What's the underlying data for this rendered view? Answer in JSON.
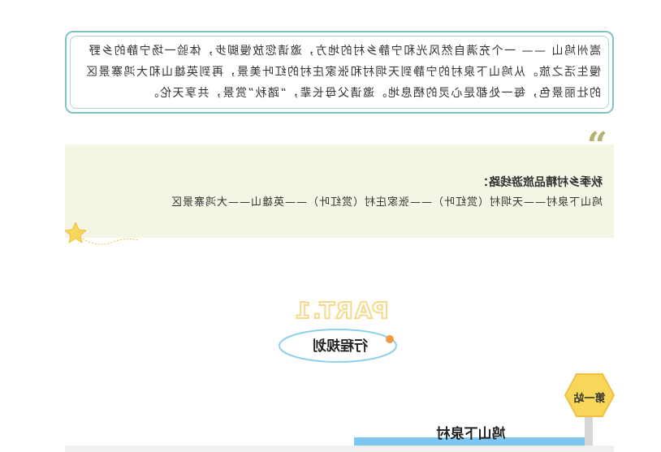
{
  "intro": {
    "text": "嵩州鸠山 —— 一个充满自然风光和宁静乡村的地方，邀请您放慢脚步，体验一场宁静的乡野慢生活之旅。从鸠山下泉村的宁静到天垌村和张家庄村的红叶美景，再到英雄山和大鸿寨景区的壮丽景色，每一处都是心灵的栖息地。邀请父母长辈，“踏秋”赏景，共享天伦。"
  },
  "route": {
    "quote_icon": "quote-mark-icon",
    "title": "秋季乡村精品旅游线路：",
    "path": "鸠山下泉村——天垌村（赏红叶）——张家庄村（赏红叶）——英雄山——大鸿寨景区"
  },
  "part": {
    "label": "PART.1",
    "title": "行程规划"
  },
  "station": {
    "label": "第一站",
    "name": "鸠山下泉村"
  },
  "colors": {
    "frame": "#7fc4c0",
    "quote_bg": "#f5f5e6",
    "accent_yellow": "#f8d65a",
    "accent_blue": "#7cc7ef",
    "accent_orange": "#f39a3c"
  }
}
